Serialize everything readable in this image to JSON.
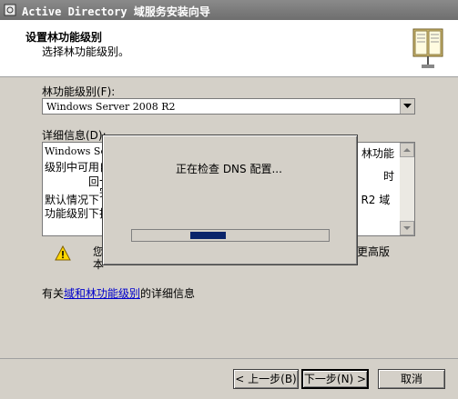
{
  "window": {
    "title": "Active Directory 域服务安装向导"
  },
  "header": {
    "title": "设置林功能级别",
    "subtitle": "选择林功能级别。"
  },
  "forest_level": {
    "label": "林功能级别(F):",
    "selected": "Windows Server 2008 R2"
  },
  "details": {
    "label": "详细信息(D):",
    "lines": [
      "Windows Ser",
      "级别中可用自",
      "回",
      "完",
      "默认情况下",
      "功能级别下技"
    ],
    "lines_right": [
      "林功能",
      "时",
      "8 R2 域"
    ]
  },
  "warning": {
    "text_left": "您",
    "text_left2": "本",
    "text_right": "更高版"
  },
  "more_info": {
    "prefix": "有关",
    "link": "域和林功能级别",
    "suffix": "的详细信息"
  },
  "progress_dialog": {
    "message": "正在检查 DNS 配置...",
    "progress_fraction": 0.18
  },
  "buttons": {
    "back": "< 上一步(B)",
    "next": "下一步(N) >",
    "cancel": "取消"
  },
  "colors": {
    "progress": "#0a246a",
    "link": "#0000cc"
  }
}
